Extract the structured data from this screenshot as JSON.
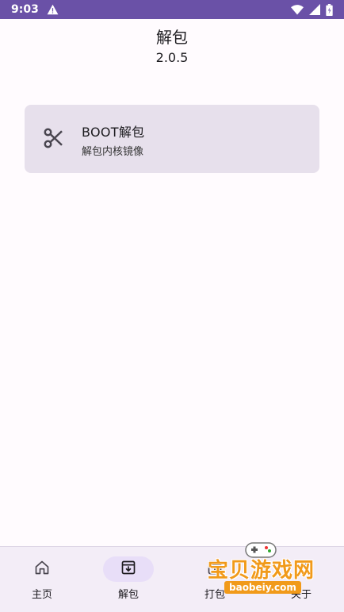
{
  "status_bar": {
    "time": "9:03"
  },
  "header": {
    "title": "解包",
    "version": "2.0.5"
  },
  "card": {
    "title": "BOOT解包",
    "subtitle": "解包内核镜像",
    "icon": "scissors-icon"
  },
  "bottom_nav": [
    {
      "label": "主页",
      "icon": "home-icon",
      "active": false
    },
    {
      "label": "解包",
      "icon": "archive-download-icon",
      "active": true
    },
    {
      "label": "打包",
      "icon": "package-icon",
      "active": false
    },
    {
      "label": "关于",
      "icon": "info-icon",
      "active": false
    }
  ],
  "watermark": {
    "text": "宝贝游戏网",
    "url": "baobeiy.com"
  },
  "colors": {
    "status_bar": "#6a51a7",
    "card": "#e7e0ec",
    "nav_bg": "#f3edf7",
    "active_pill": "#e8def8",
    "watermark": "#f19a1a"
  }
}
